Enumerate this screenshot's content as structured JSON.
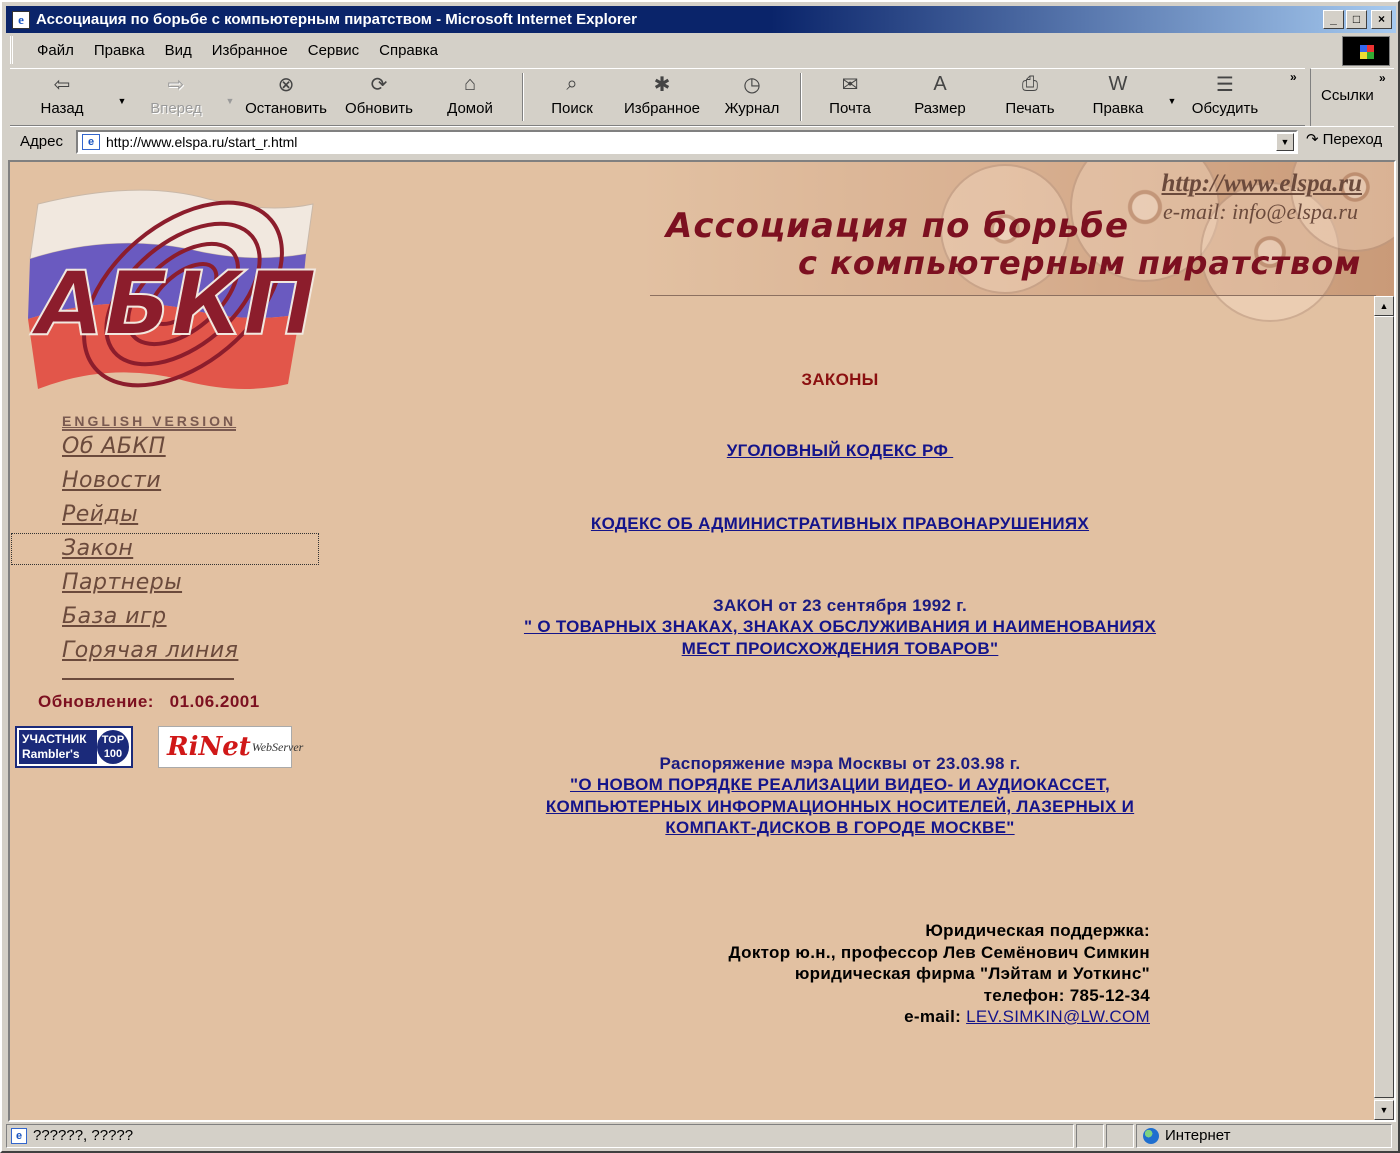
{
  "window": {
    "title": "Ассоциация по борьбе с компьютерным пиратством - Microsoft Internet Explorer"
  },
  "menu": [
    "Файл",
    "Правка",
    "Вид",
    "Избранное",
    "Сервис",
    "Справка"
  ],
  "toolbar": {
    "back": "Назад",
    "forward": "Вперед",
    "stop": "Остановить",
    "refresh": "Обновить",
    "home": "Домой",
    "search": "Поиск",
    "favorites": "Избранное",
    "history": "Журнал",
    "mail": "Почта",
    "size": "Размер",
    "print": "Печать",
    "edit": "Правка",
    "discuss": "Обсудить",
    "links": "Ссылки"
  },
  "address": {
    "label": "Адрес",
    "url": "http://www.elspa.ru/start_r.html",
    "go": "Переход"
  },
  "header": {
    "url": "http://www.elspa.ru",
    "email": "e-mail: info@elspa.ru",
    "title_line1": "Ассоциация по борьбе",
    "title_line2": "с компьютерным пиратством"
  },
  "sidebar": {
    "logo_text": "АБКП",
    "english_version": "ENGLISH VERSION",
    "items": [
      {
        "label": "Об АБКП"
      },
      {
        "label": "Новости"
      },
      {
        "label": "Рейды"
      },
      {
        "label": "Закон"
      },
      {
        "label": "Партнеры"
      },
      {
        "label": "База игр"
      },
      {
        "label": "Горячая линия"
      }
    ],
    "update": "Обновление:   01.06.2001",
    "rambler_banner": {
      "line1": "УЧАСТНИК",
      "line2": "Rambler's",
      "badge": "TOP",
      "badge2": "100"
    },
    "rinet_banner": {
      "brand": "RiNet",
      "sub": "WebServer"
    }
  },
  "content": {
    "laws_heading": "ЗАКОНЫ",
    "criminal_code": "УГОЛОВНЫЙ КОДЕКС РФ ",
    "admin_code": "КОДЕКС ОБ АДМИНИСТРАТИВНЫХ ПРАВОНАРУШЕНИЯХ",
    "law1992_title": "ЗАКОН от 23 сентября 1992 г.",
    "law1992_line1": "\" О ТОВАРНЫХ ЗНАКАХ, ЗНАКАХ ОБСЛУЖИВАНИЯ И НАИМЕНОВАНИЯХ",
    "law1992_line2": "МЕСТ ПРОИСХОЖДЕНИЯ ТОВАРОВ\"",
    "order_title": "Распоряжение мэра Москвы от 23.03.98 г.",
    "order_line1": "\"О НОВОМ ПОРЯДКЕ РЕАЛИЗАЦИИ ВИДЕО- И АУДИОКАССЕТ,",
    "order_line2": "КОМПЬЮТЕРНЫХ ИНФОРМАЦИОННЫХ НОСИТЕЛЕЙ, ЛАЗЕРНЫХ И",
    "order_line3": "КОМПАКТ-ДИСКОВ В ГОРОДЕ МОСКВЕ\"",
    "legal": {
      "line1": "Юридическая поддержка:",
      "line2": "Доктор ю.н., профессор Лев Семёнович Симкин",
      "line3": "юридическая фирма \"Лэйтам и Уоткинс\"",
      "line4": "телефон: 785-12-34",
      "email_label": "e-mail: ",
      "email": "LEV.SIMKIN@LW.COM"
    }
  },
  "status": {
    "text": "??????, ?????",
    "zone": "Интернет"
  }
}
